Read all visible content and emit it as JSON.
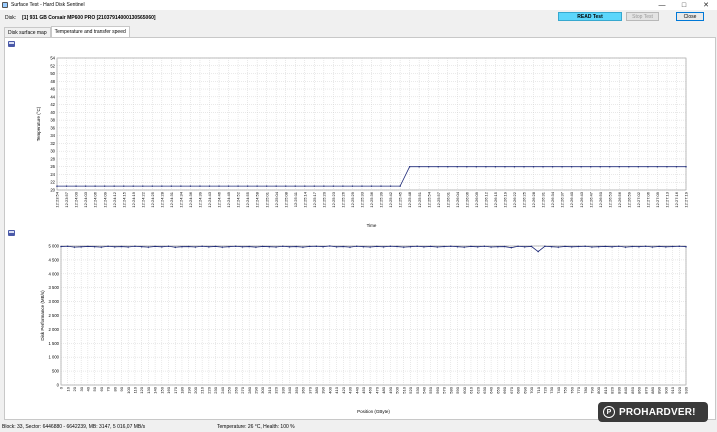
{
  "window": {
    "title": "Surface Test - Hard Disk Sentinel",
    "minimize": "—",
    "maximize": "□",
    "close": "✕"
  },
  "toolbar": {
    "disk_label": "Disk:",
    "disk_value": "[1] 931 GB  Corsair MP600 PRO [21037914000130565060]",
    "read_test": "READ Test",
    "stop_test": "Stop Test",
    "close": "Close"
  },
  "tabs": [
    {
      "label": "Disk surface map",
      "active": false
    },
    {
      "label": "Temperature and transfer speed",
      "active": true
    }
  ],
  "icons": {
    "print": "printer-icon"
  },
  "chart_data": [
    {
      "type": "line",
      "ylabel": "Temperature (°C)",
      "xlabel": "Time",
      "ylim": [
        20,
        54
      ],
      "yticks": [
        20,
        22,
        24,
        26,
        28,
        30,
        32,
        34,
        36,
        38,
        40,
        42,
        44,
        46,
        48,
        50,
        52,
        54
      ],
      "x": [
        "12:23:54",
        "12:23:57",
        "12:24:00",
        "12:24:03",
        "12:24:06",
        "12:24:09",
        "12:24:12",
        "12:24:15",
        "12:24:19",
        "12:24:22",
        "12:24:25",
        "12:24:28",
        "12:24:31",
        "12:24:34",
        "12:24:36",
        "12:24:39",
        "12:24:43",
        "12:24:46",
        "12:24:49",
        "12:24:52",
        "12:24:55",
        "12:24:58",
        "12:25:01",
        "12:25:04",
        "12:25:08",
        "12:25:11",
        "12:25:14",
        "12:25:17",
        "12:25:20",
        "12:25:23",
        "12:25:26",
        "12:25:29",
        "12:25:33",
        "12:25:36",
        "12:25:39",
        "12:25:42",
        "12:25:45",
        "12:25:48",
        "12:25:51",
        "12:25:54",
        "12:25:57",
        "12:26:01",
        "12:26:04",
        "12:26:06",
        "12:26:09",
        "12:26:12",
        "12:26:15",
        "12:26:19",
        "12:26:22",
        "12:26:25",
        "12:26:28",
        "12:26:31",
        "12:26:34",
        "12:26:37",
        "12:26:40",
        "12:26:43",
        "12:26:47",
        "12:26:50",
        "12:26:53",
        "12:26:56",
        "12:26:59",
        "12:27:02",
        "12:27:06",
        "12:27:09",
        "12:27:13",
        "12:27:16",
        "12:27:19"
      ],
      "series": [
        {
          "values": [
            21,
            21,
            21,
            21,
            21,
            21,
            21,
            21,
            21,
            21,
            21,
            21,
            21,
            21,
            21,
            21,
            21,
            21,
            21,
            21,
            21,
            21,
            21,
            21,
            21,
            21,
            21,
            21,
            21,
            21,
            21,
            21,
            21,
            21,
            21,
            21,
            21,
            26,
            26,
            26,
            26,
            26,
            26,
            26,
            26,
            26,
            26,
            26,
            26,
            26,
            26,
            26,
            26,
            26,
            26,
            26,
            26,
            26,
            26,
            26,
            26,
            26,
            26,
            26,
            26,
            26,
            26
          ],
          "color": "#1f2a78"
        }
      ],
      "grid": true
    },
    {
      "type": "line",
      "ylabel": "Disk Performance (MB/s)",
      "xlabel": "Position (GByte)",
      "ylim": [
        0,
        5000
      ],
      "yticks": [
        0,
        500,
        1000,
        1500,
        2000,
        2500,
        3000,
        3500,
        4000,
        4500,
        5000
      ],
      "ytick_labels": [
        "0",
        "500",
        "1 000",
        "1 500",
        "2 000",
        "2 500",
        "3 000",
        "3 500",
        "4 000",
        "4 500",
        "5 000"
      ],
      "x": [
        0,
        10,
        20,
        30,
        40,
        50,
        60,
        70,
        80,
        90,
        100,
        110,
        120,
        130,
        140,
        150,
        160,
        170,
        180,
        190,
        200,
        210,
        220,
        230,
        240,
        250,
        260,
        270,
        280,
        290,
        300,
        310,
        320,
        330,
        340,
        350,
        360,
        370,
        380,
        390,
        400,
        410,
        420,
        430,
        440,
        450,
        460,
        470,
        480,
        490,
        500,
        510,
        520,
        530,
        540,
        550,
        560,
        570,
        580,
        590,
        600,
        610,
        620,
        630,
        640,
        650,
        660,
        670,
        680,
        690,
        700,
        710,
        720,
        730,
        740,
        750,
        760,
        770,
        780,
        790,
        800,
        810,
        820,
        830,
        840,
        850,
        860,
        870,
        880,
        890,
        900,
        910,
        920,
        930
      ],
      "series": [
        {
          "values": [
            4980,
            4990,
            4960,
            4970,
            4985,
            4975,
            4960,
            4990,
            4970,
            4980,
            4965,
            4990,
            4975,
            4960,
            4985,
            4970,
            4990,
            4955,
            4975,
            4980,
            4965,
            4990,
            4970,
            4985,
            4960,
            4975,
            4990,
            4970,
            4980,
            4960,
            4985,
            4975,
            4965,
            4990,
            4970,
            4980,
            4960,
            4985,
            4990,
            4975,
            5000,
            4970,
            4980,
            4960,
            4990,
            4975,
            4965,
            4985,
            4970,
            4990,
            4980,
            4960,
            4975,
            4990,
            4970,
            4985,
            4965,
            4980,
            4990,
            4975,
            4960,
            4985,
            4970,
            4990,
            4965,
            4975,
            4980,
            4940,
            4990,
            4970,
            4985,
            4800,
            4990,
            4975,
            4960,
            4985,
            4970,
            4980,
            4990,
            4965,
            4975,
            4985,
            4970,
            4990,
            4960,
            4980,
            4975,
            4990,
            4965,
            4985,
            4970,
            4980,
            4990,
            4975
          ],
          "color": "#1f2a78"
        }
      ],
      "grid": true
    }
  ],
  "status": {
    "left": "Block: 33, Sector: 6446880 - 6642239, MB: 3147, 5 016,07 MB/s",
    "middle": "Temperature: 26  °C,  Health: 100 %"
  },
  "watermark": {
    "text": "PROHARDVER!",
    "mark": "P"
  }
}
